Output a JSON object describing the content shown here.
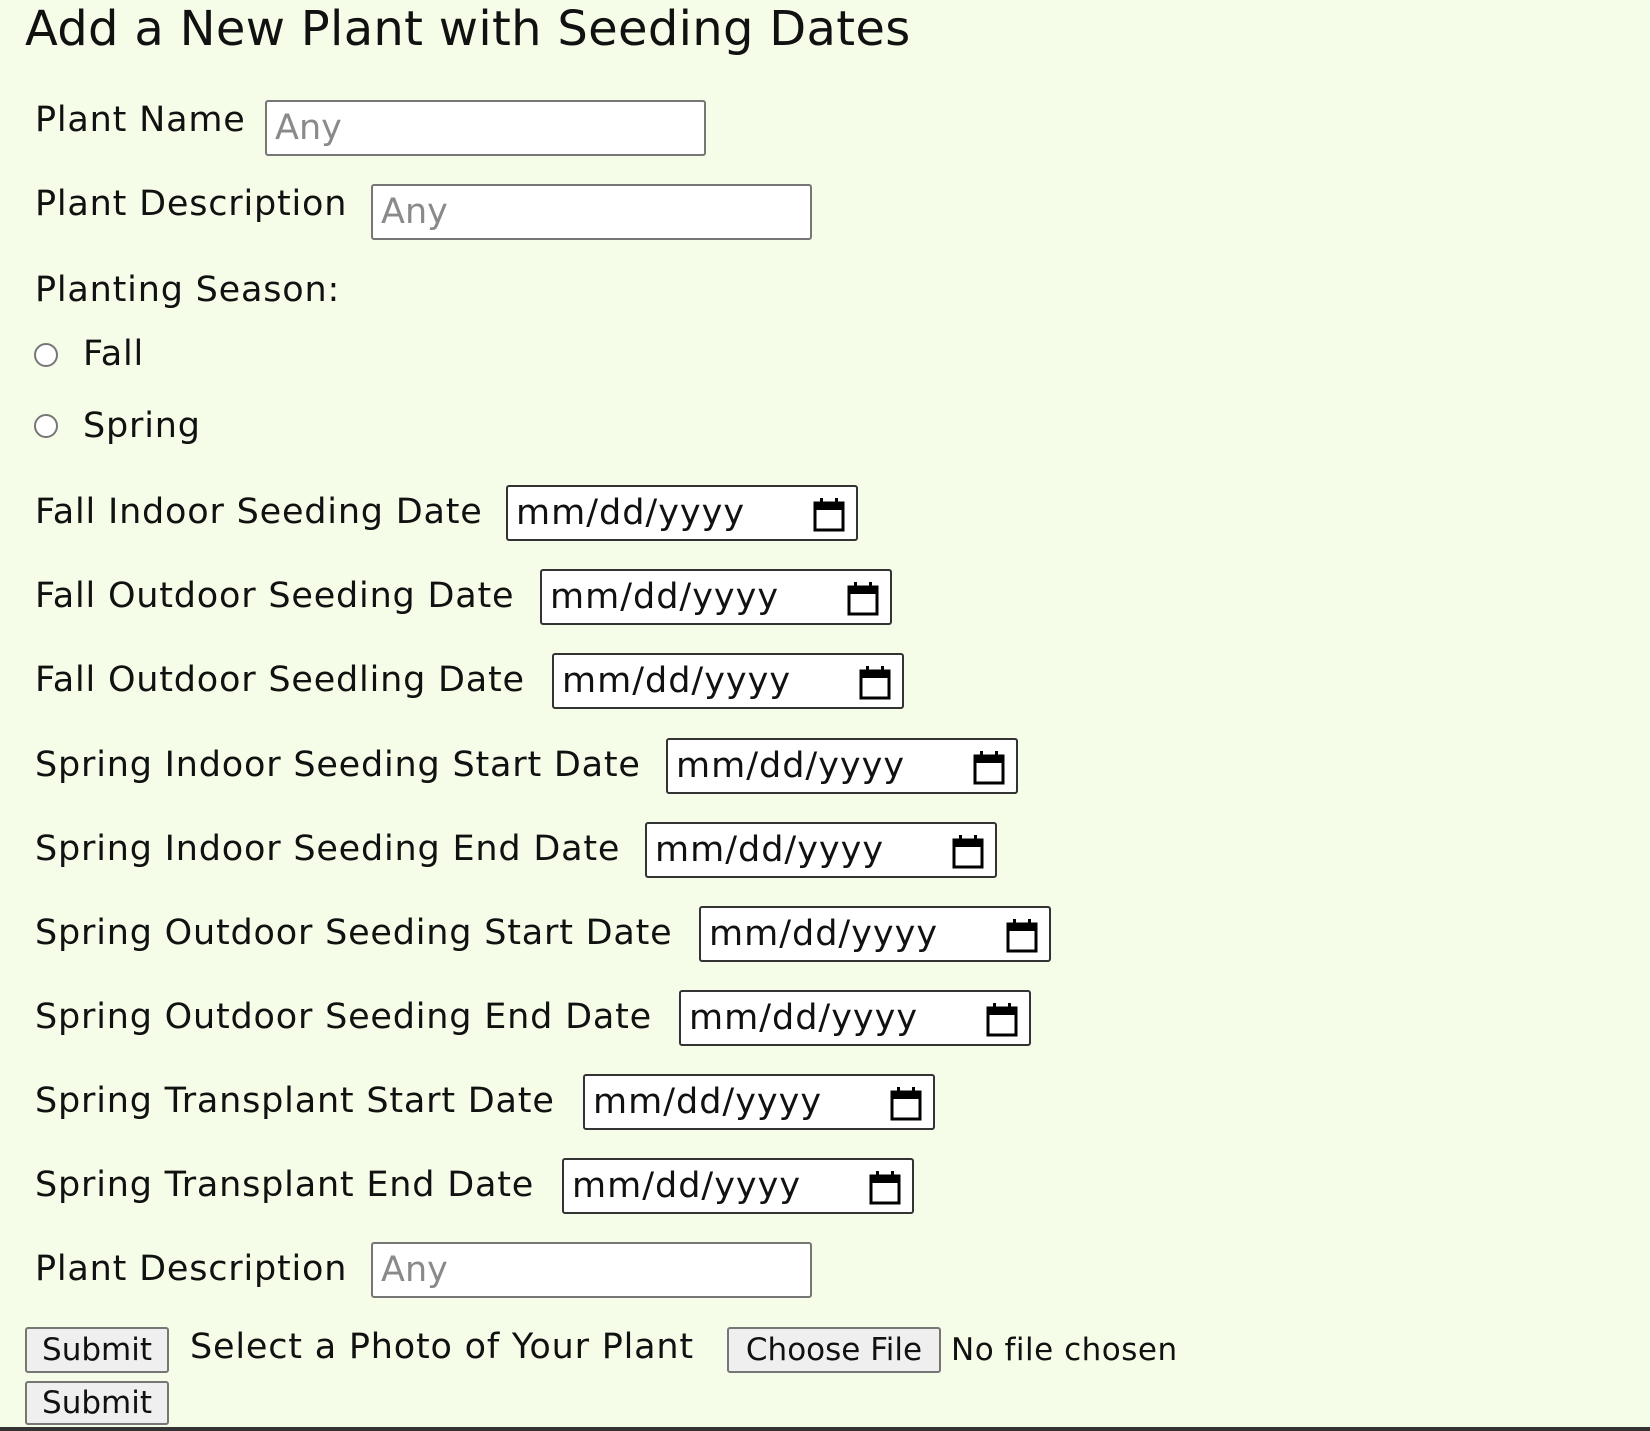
{
  "page": {
    "title": "Add a New Plant with Seeding Dates"
  },
  "form": {
    "plant_name": {
      "label": "Plant Name",
      "placeholder": "Any",
      "value": ""
    },
    "plant_description": {
      "label": "Plant Description",
      "placeholder": "Any",
      "value": ""
    },
    "planting_season": {
      "label": "Planting Season:",
      "options": [
        {
          "label": "Fall",
          "checked": false
        },
        {
          "label": "Spring",
          "checked": false
        }
      ]
    },
    "date_fields": [
      {
        "label": "Fall Indoor Seeding Date",
        "value": "mm/dd/yyyy"
      },
      {
        "label": "Fall Outdoor Seeding Date",
        "value": "mm/dd/yyyy"
      },
      {
        "label": "Fall Outdoor Seedling Date",
        "value": "mm/dd/yyyy"
      },
      {
        "label": "Spring Indoor Seeding Start Date",
        "value": "mm/dd/yyyy"
      },
      {
        "label": "Spring Indoor Seeding End Date",
        "value": "mm/dd/yyyy"
      },
      {
        "label": "Spring Outdoor Seeding Start Date",
        "value": "mm/dd/yyyy"
      },
      {
        "label": "Spring Outdoor Seeding End Date",
        "value": "mm/dd/yyyy"
      },
      {
        "label": "Spring Transplant Start Date",
        "value": "mm/dd/yyyy"
      },
      {
        "label": "Spring Transplant End Date",
        "value": "mm/dd/yyyy"
      }
    ],
    "plant_description_2": {
      "label": "Plant Description",
      "placeholder": "Any",
      "value": ""
    },
    "submit_label": "Submit",
    "photo": {
      "label": "Select a Photo of Your Plant",
      "button_label": "Choose File",
      "status": "No file chosen"
    },
    "submit_label_2": "Submit"
  },
  "icons": {
    "date_picker": "calendar-icon",
    "radio": "radio-circle"
  },
  "colors": {
    "page_background": "#f5fde8",
    "input_border": "#767676",
    "button_background": "#efefef",
    "placeholder_text": "#8a8a8a"
  }
}
